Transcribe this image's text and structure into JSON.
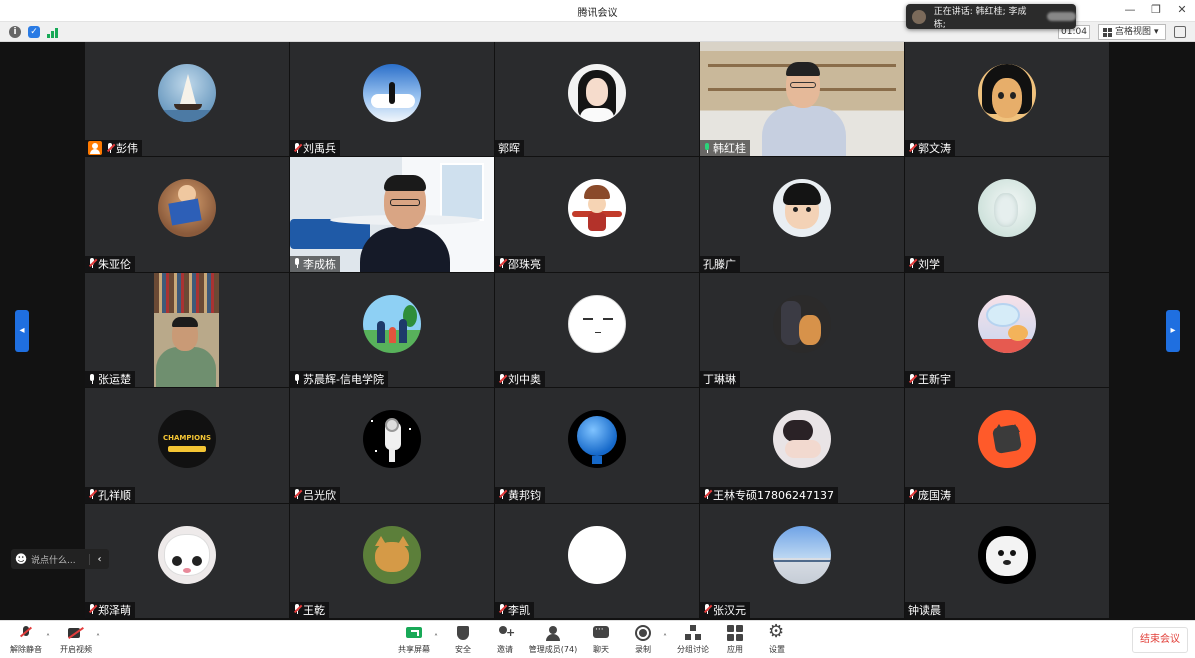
{
  "window": {
    "title": "腾讯会议"
  },
  "infobar": {
    "timer": "01:04",
    "view_mode": "宫格视图"
  },
  "speaker_toast": {
    "label": "正在讲话: 韩红桂; 李成栋;"
  },
  "participants": [
    {
      "name": "彭伟",
      "mic": "muted",
      "host": true
    },
    {
      "name": "刘禹兵",
      "mic": "muted"
    },
    {
      "name": "郭晖",
      "mic": "none"
    },
    {
      "name": "韩红桂",
      "mic": "speaking"
    },
    {
      "name": "郭文涛",
      "mic": "muted"
    },
    {
      "name": "朱亚伦",
      "mic": "muted"
    },
    {
      "name": "李成栋",
      "mic": "on"
    },
    {
      "name": "邵珠亮",
      "mic": "muted"
    },
    {
      "name": "孔滕广",
      "mic": "none"
    },
    {
      "name": "刘学",
      "mic": "muted"
    },
    {
      "name": "张运楚",
      "mic": "on"
    },
    {
      "name": "苏晨辉-信电学院",
      "mic": "on"
    },
    {
      "name": "刘中奥",
      "mic": "muted"
    },
    {
      "name": "丁琳琳",
      "mic": "none"
    },
    {
      "name": "王新宇",
      "mic": "muted"
    },
    {
      "name": "孔祥顺",
      "mic": "muted"
    },
    {
      "name": "吕光欣",
      "mic": "muted"
    },
    {
      "name": "黄邦钧",
      "mic": "muted"
    },
    {
      "name": "王林专硕17806247137",
      "mic": "muted"
    },
    {
      "name": "庞国涛",
      "mic": "muted"
    },
    {
      "name": "郑泽萌",
      "mic": "muted"
    },
    {
      "name": "王乾",
      "mic": "muted"
    },
    {
      "name": "李凯",
      "mic": "muted"
    },
    {
      "name": "张汉元",
      "mic": "muted"
    },
    {
      "name": "钟读晨",
      "mic": "none"
    }
  ],
  "champions_text": "CHAMPIONS",
  "chat": {
    "placeholder": "说点什么..."
  },
  "toolbar": {
    "unmute": "解除静音",
    "start_video": "开启视频",
    "share_screen": "共享屏幕",
    "security": "安全",
    "invite": "邀请",
    "manage_members": "管理成员(74)",
    "chat": "聊天",
    "record": "录制",
    "breakout": "分组讨论",
    "apps": "应用",
    "settings": "设置",
    "end_meeting": "结束会议"
  },
  "colors": {
    "accent": "#1f6fe0",
    "share_green": "#18a957",
    "end_red": "#e2413b",
    "host_orange": "#ff7a00"
  }
}
